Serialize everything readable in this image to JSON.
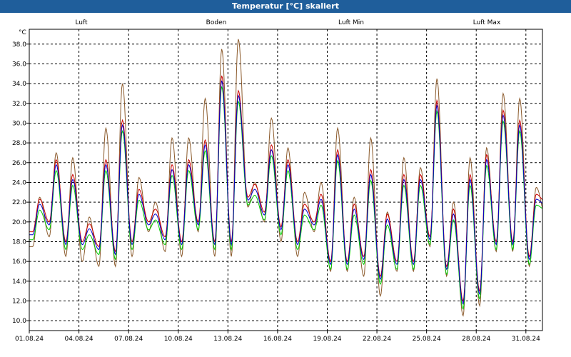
{
  "window_title": "Temperatur [°C] skaliert",
  "chart_data": {
    "type": "line",
    "title": "Temperatur [°C] skaliert",
    "ylabel": "°C",
    "ylim": [
      9.0,
      39.5
    ],
    "yticks": [
      "10.0",
      "12.0",
      "14.0",
      "16.0",
      "18.0",
      "20.0",
      "22.0",
      "24.0",
      "26.0",
      "28.0",
      "30.0",
      "32.0",
      "34.0",
      "36.0",
      "38.0"
    ],
    "xlim": [
      "01.08.24",
      "01.09.24"
    ],
    "xticks": [
      "01.08.24",
      "04.08.24",
      "07.08.24",
      "10.08.24",
      "13.08.24",
      "16.08.24",
      "19.08.24",
      "22.08.24",
      "25.08.24",
      "28.08.24",
      "31.08.24"
    ],
    "grid": true,
    "legend_position": "top",
    "series": [
      {
        "name": "Luft",
        "color": "#0000cc"
      },
      {
        "name": "Boden",
        "color": "#8b5a2b"
      },
      {
        "name": "Luft Min",
        "color": "#00cc00"
      },
      {
        "name": "Luft Max",
        "color": "#cc0000"
      }
    ],
    "daily_extremes": {
      "dates": [
        "01.08.24",
        "02.08.24",
        "03.08.24",
        "04.08.24",
        "05.08.24",
        "06.08.24",
        "07.08.24",
        "08.08.24",
        "09.08.24",
        "10.08.24",
        "11.08.24",
        "12.08.24",
        "13.08.24",
        "14.08.24",
        "15.08.24",
        "16.08.24",
        "17.08.24",
        "18.08.24",
        "19.08.24",
        "20.08.24",
        "21.08.24",
        "22.08.24",
        "23.08.24",
        "24.08.24",
        "25.08.24",
        "26.08.24",
        "27.08.24",
        "28.08.24",
        "29.08.24",
        "30.08.24",
        "31.08.24",
        "01.09.24"
      ],
      "luft_min": [
        18.5,
        19.5,
        17.5,
        17.5,
        17.0,
        16.5,
        17.5,
        19.5,
        18.0,
        17.5,
        19.5,
        17.5,
        17.5,
        22.0,
        20.5,
        19.0,
        17.5,
        19.5,
        15.5,
        15.5,
        16.0,
        14.0,
        15.5,
        15.5,
        18.0,
        15.0,
        11.5,
        12.5,
        17.5,
        17.5,
        16.0,
        21.5
      ],
      "luft_max": [
        22.0,
        26.0,
        24.5,
        19.5,
        26.0,
        30.0,
        23.0,
        21.0,
        25.5,
        26.0,
        28.0,
        34.5,
        33.0,
        23.5,
        27.5,
        26.0,
        21.5,
        22.5,
        27.0,
        21.5,
        25.0,
        20.5,
        24.5,
        24.5,
        32.0,
        21.0,
        24.5,
        26.5,
        31.0,
        30.0,
        22.5,
        27.5
      ],
      "boden_min": [
        17.5,
        18.5,
        16.5,
        16.0,
        15.5,
        15.5,
        16.5,
        19.0,
        17.0,
        16.5,
        19.0,
        16.5,
        16.5,
        21.5,
        20.0,
        18.0,
        16.5,
        19.0,
        15.0,
        15.0,
        14.5,
        12.5,
        15.0,
        15.0,
        17.5,
        14.5,
        10.5,
        11.5,
        17.0,
        17.0,
        15.5,
        20.5
      ],
      "boden_max": [
        22.5,
        27.0,
        26.5,
        20.5,
        29.5,
        34.0,
        24.5,
        22.0,
        28.5,
        28.5,
        32.5,
        37.5,
        38.5,
        24.0,
        30.5,
        27.5,
        23.0,
        24.0,
        29.5,
        22.5,
        28.5,
        21.0,
        26.5,
        25.5,
        34.5,
        22.0,
        26.5,
        27.5,
        33.0,
        32.5,
        23.5,
        29.5
      ]
    }
  }
}
